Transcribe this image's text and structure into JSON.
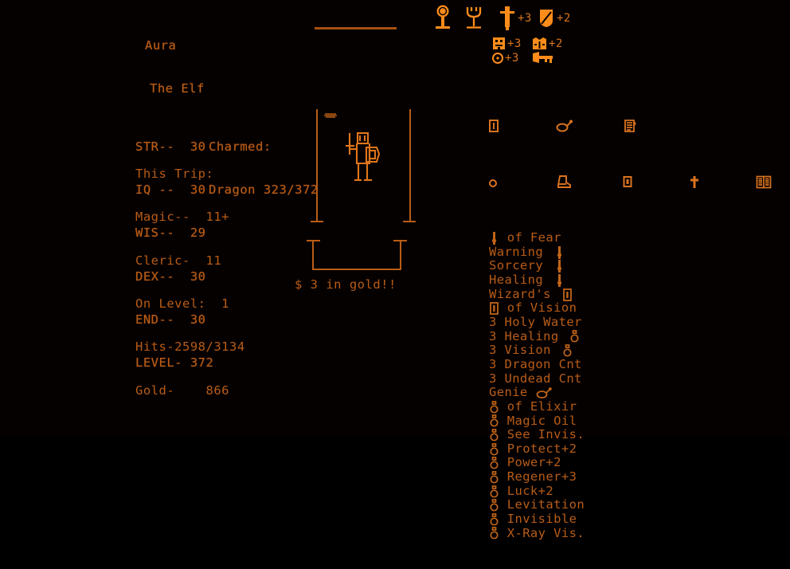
{
  "meta": {
    "accent_text": "#b85c17",
    "accent_icon": "#ff8c1a",
    "accent_bright": "#d9731f",
    "background": "#050100"
  },
  "character": {
    "name": "Aura",
    "class": "The Elf",
    "stats": [
      {
        "label": "STR--",
        "value": "30"
      },
      {
        "label": "IQ --",
        "value": "30"
      },
      {
        "label": "WIS--",
        "value": "29"
      },
      {
        "label": "DEX--",
        "value": "30"
      },
      {
        "label": "END--",
        "value": "30"
      },
      {
        "label": "LEVEL-",
        "value": "372"
      }
    ],
    "charmed": {
      "header": "Charmed:",
      "creature": "Dragon",
      "hits": "323/372"
    }
  },
  "trip": {
    "header": "This Trip:",
    "rows": [
      {
        "label": "Magic--",
        "value": "11+"
      },
      {
        "label": "Cleric-",
        "value": "11"
      },
      {
        "label": "On Level:",
        "value": "1"
      },
      {
        "label": "Hits-",
        "value": "2598/3134"
      },
      {
        "label": "Gold-",
        "value": "866"
      }
    ]
  },
  "dungeon": {
    "gold_message": "$ 3 in gold!!"
  },
  "equipment": [
    {
      "name": "statue-left",
      "icon": "statue-orb",
      "bonus": ""
    },
    {
      "name": "statue-right",
      "icon": "statue-cup",
      "bonus": ""
    },
    {
      "name": "sword",
      "icon": "sword-icon",
      "bonus": "+3"
    },
    {
      "name": "shield",
      "icon": "shield-icon",
      "bonus": "+2"
    },
    {
      "name": "helmet",
      "icon": "helmet-icon",
      "bonus": "+3"
    },
    {
      "name": "armor",
      "icon": "armor-icon",
      "bonus": "+2"
    },
    {
      "name": "ring",
      "icon": "ring-icon",
      "bonus": "+3"
    },
    {
      "name": "horn",
      "icon": "horn-icon",
      "bonus": ""
    }
  ],
  "inventory": {
    "icon_row_1": [
      "scroll-tube-icon",
      "lamp-icon",
      "hand-scroll-icon"
    ],
    "icon_row_2": [
      "ring-icon",
      "boots-icon",
      "flask-box-icon",
      "cross-icon",
      "book-icon"
    ],
    "items": [
      {
        "lead_icon": "wand-icon",
        "text": " of Fear",
        "trail_icon": ""
      },
      {
        "lead_icon": "",
        "text": "Warning ",
        "trail_icon": "wand-icon"
      },
      {
        "lead_icon": "",
        "text": "Sorcery ",
        "trail_icon": "wand-icon"
      },
      {
        "lead_icon": "",
        "text": "Healing ",
        "trail_icon": "wand-icon"
      },
      {
        "lead_icon": "",
        "text": "Wizard's ",
        "trail_icon": "scroll-tube-icon"
      },
      {
        "lead_icon": "scroll-tube-icon",
        "text": " of Vision",
        "trail_icon": ""
      },
      {
        "lead_icon": "",
        "text": "3 Holy Water",
        "trail_icon": ""
      },
      {
        "lead_icon": "",
        "text": "3 Healing ",
        "trail_icon": "potion-icon"
      },
      {
        "lead_icon": "",
        "text": "3 Vision ",
        "trail_icon": "potion-icon"
      },
      {
        "lead_icon": "",
        "text": "3 Dragon Cnt",
        "trail_icon": ""
      },
      {
        "lead_icon": "",
        "text": "3 Undead Cnt",
        "trail_icon": ""
      },
      {
        "lead_icon": "",
        "text": "Genie ",
        "trail_icon": "lamp-icon"
      },
      {
        "lead_icon": "potion-icon",
        "text": " of Elixir",
        "trail_icon": ""
      },
      {
        "lead_icon": "potion-icon",
        "text": " Magic Oil",
        "trail_icon": ""
      },
      {
        "lead_icon": "potion-icon",
        "text": " See Invis.",
        "trail_icon": ""
      },
      {
        "lead_icon": "potion-icon",
        "text": " Protect+2",
        "trail_icon": ""
      },
      {
        "lead_icon": "potion-icon",
        "text": " Power+2",
        "trail_icon": ""
      },
      {
        "lead_icon": "potion-icon",
        "text": " Regener+3",
        "trail_icon": ""
      },
      {
        "lead_icon": "potion-icon",
        "text": " Luck+2",
        "trail_icon": ""
      },
      {
        "lead_icon": "potion-icon",
        "text": " Levitation",
        "trail_icon": ""
      },
      {
        "lead_icon": "potion-icon",
        "text": " Invisible",
        "trail_icon": ""
      },
      {
        "lead_icon": "potion-icon",
        "text": " X-Ray Vis.",
        "trail_icon": ""
      }
    ]
  }
}
